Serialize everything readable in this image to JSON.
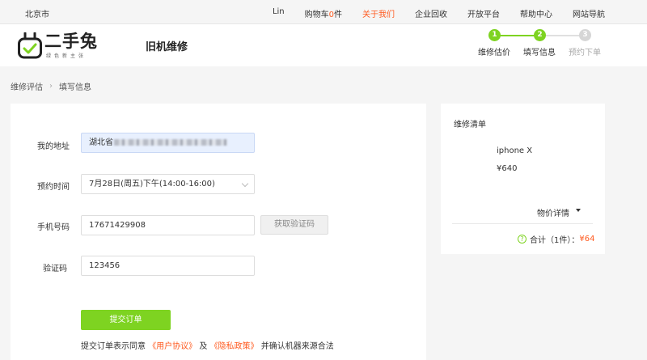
{
  "topbar": {
    "city": "北京市",
    "user": "Lin",
    "cart_label": "购物车",
    "cart_count": "0",
    "cart_unit": "件",
    "about": "关于我们",
    "enterprise": "企业回收",
    "open_platform": "开放平台",
    "help": "帮助中心",
    "site_nav": "网站导航"
  },
  "header": {
    "logo_text": "二手兔",
    "logo_sub": "绿色新主张",
    "page_title": "旧机维修",
    "steps": [
      {
        "num": "1",
        "label": "维修估价",
        "state": "done"
      },
      {
        "num": "2",
        "label": "填写信息",
        "state": "current"
      },
      {
        "num": "3",
        "label": "预约下单",
        "state": "pending"
      }
    ]
  },
  "breadcrumb": {
    "first": "维修评估",
    "separator": "›",
    "second": "填写信息"
  },
  "form": {
    "address_label": "我的地址",
    "address_value": "湖北省",
    "time_label": "预约时间",
    "time_value": "7月28日(周五)下午(14:00-16:00)",
    "phone_label": "手机号码",
    "phone_value": "17671429908",
    "get_code_button": "获取验证码",
    "code_label": "验证码",
    "code_value": "123456",
    "submit_button": "提交订单",
    "agreement_prefix": "提交订单表示同意",
    "user_agreement": "《用户协议》",
    "and": "及",
    "privacy_policy": "《隐私政策》",
    "agreement_suffix": "并确认机器来源合法"
  },
  "order": {
    "title": "维修清单",
    "product_name": "iphone X",
    "product_price": "¥640",
    "detail_link": "物价详情",
    "total_label": "合计（1件）：",
    "total_amount": "¥64"
  },
  "colors": {
    "accent_green": "#7ed321",
    "accent_orange": "#ff5a1f"
  }
}
